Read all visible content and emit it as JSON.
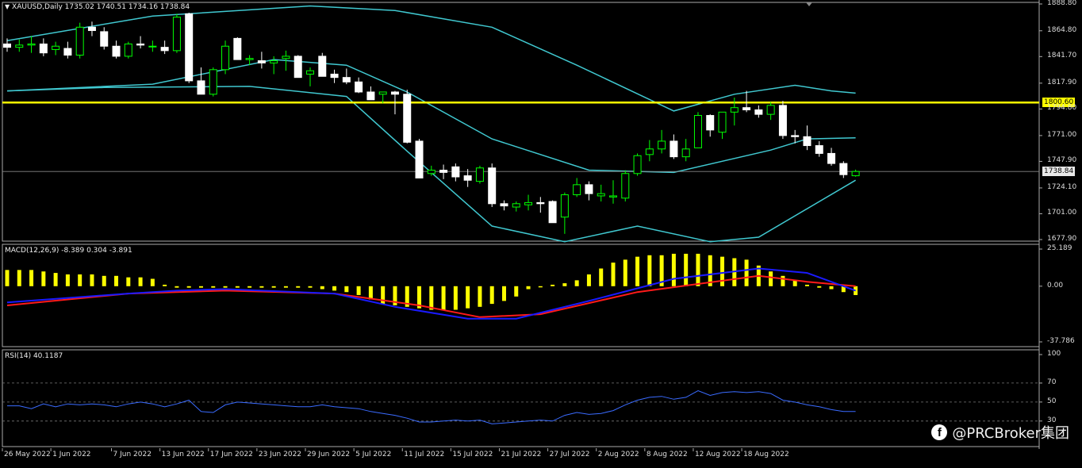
{
  "header": {
    "symbol_line": "XAUUSD,Daily  1735.02 1740.51 1734.16 1738.84",
    "macd_label": "MACD(12,26,9) -8.389 0.304 -3.891",
    "rsi_label": "RSI(14) 40.1187"
  },
  "price_tags": {
    "resistance": "1800.60",
    "last": "1738.84"
  },
  "watermark": {
    "text": "@PRCBroker集团",
    "icon": "facebook-icon"
  },
  "colors": {
    "background": "#000000",
    "bull": "#00ff00",
    "bear_fill": "#ffffff",
    "bollinger": "#40c8d0",
    "resistance": "#ffff00",
    "macd_hist": "#ffff00",
    "macd_line": "#1a1aff",
    "signal_line": "#ff1a1a",
    "rsi_line": "#3a6bff"
  },
  "chart_data": [
    {
      "type": "candlestick",
      "title": "XAUUSD,Daily",
      "y_ticks": [
        "1888.80",
        "1864.80",
        "1841.70",
        "1817.90",
        "1794.80",
        "1771.00",
        "1747.90",
        "1724.10",
        "1701.00",
        "1677.90"
      ],
      "ylim": [
        1677.9,
        1888.8
      ],
      "x_ticks": [
        "26 May 2022",
        "1 Jun 2022",
        "7 Jun 2022",
        "13 Jun 2022",
        "17 Jun 2022",
        "23 Jun 2022",
        "29 Jun 2022",
        "5 Jul 2022",
        "11 Jul 2022",
        "15 Jul 2022",
        "21 Jul 2022",
        "27 Jul 2022",
        "2 Aug 2022",
        "8 Aug 2022",
        "12 Aug 2022",
        "18 Aug 2022"
      ],
      "last_bar": {
        "open": 1735.02,
        "high": 1740.51,
        "low": 1734.16,
        "close": 1738.84
      },
      "resistance": 1800.6,
      "ohlc": [
        [
          1853,
          1858,
          1846,
          1850
        ],
        [
          1850,
          1857,
          1846,
          1852
        ],
        [
          1852,
          1860,
          1845,
          1853
        ],
        [
          1853,
          1858,
          1842,
          1845
        ],
        [
          1848,
          1855,
          1843,
          1851
        ],
        [
          1849,
          1855,
          1840,
          1843
        ],
        [
          1843,
          1872,
          1840,
          1868
        ],
        [
          1868,
          1873,
          1860,
          1865
        ],
        [
          1864,
          1868,
          1848,
          1851
        ],
        [
          1851,
          1856,
          1840,
          1842
        ],
        [
          1842,
          1855,
          1840,
          1853
        ],
        [
          1853,
          1860,
          1849,
          1852
        ],
        [
          1851,
          1856,
          1846,
          1851
        ],
        [
          1850,
          1856,
          1844,
          1847
        ],
        [
          1847,
          1880,
          1845,
          1877
        ],
        [
          1880,
          1881,
          1818,
          1820
        ],
        [
          1820,
          1832,
          1808,
          1808
        ],
        [
          1808,
          1832,
          1806,
          1830
        ],
        [
          1830,
          1856,
          1826,
          1851
        ],
        [
          1858,
          1859,
          1842,
          1839
        ],
        [
          1839,
          1843,
          1834,
          1840
        ],
        [
          1838,
          1846,
          1831,
          1836
        ],
        [
          1836,
          1842,
          1826,
          1838
        ],
        [
          1840,
          1847,
          1829,
          1842
        ],
        [
          1842,
          1843,
          1823,
          1823
        ],
        [
          1826,
          1832,
          1815,
          1829
        ],
        [
          1842,
          1845,
          1824,
          1824
        ],
        [
          1826,
          1830,
          1818,
          1823
        ],
        [
          1823,
          1831,
          1817,
          1819
        ],
        [
          1819,
          1823,
          1809,
          1810
        ],
        [
          1810,
          1815,
          1803,
          1803
        ],
        [
          1808,
          1810,
          1800,
          1810
        ],
        [
          1810,
          1811,
          1790,
          1808
        ],
        [
          1808,
          1812,
          1764,
          1765
        ],
        [
          1766,
          1768,
          1733,
          1733
        ],
        [
          1737,
          1744,
          1735,
          1740
        ],
        [
          1740,
          1745,
          1732,
          1738
        ],
        [
          1743,
          1746,
          1730,
          1734
        ],
        [
          1735,
          1741,
          1725,
          1731
        ],
        [
          1730,
          1744,
          1728,
          1742
        ],
        [
          1742,
          1746,
          1707,
          1710
        ],
        [
          1710,
          1713,
          1704,
          1708
        ],
        [
          1707,
          1712,
          1703,
          1710
        ],
        [
          1709,
          1718,
          1704,
          1711
        ],
        [
          1711,
          1716,
          1702,
          1710
        ],
        [
          1712,
          1713,
          1700,
          1693
        ],
        [
          1698,
          1720,
          1683,
          1718
        ],
        [
          1718,
          1733,
          1716,
          1727
        ],
        [
          1727,
          1730,
          1713,
          1719
        ],
        [
          1717,
          1727,
          1712,
          1719
        ],
        [
          1716,
          1731,
          1710,
          1717
        ],
        [
          1715,
          1740,
          1712,
          1737
        ],
        [
          1737,
          1755,
          1735,
          1753
        ],
        [
          1754,
          1767,
          1748,
          1759
        ],
        [
          1759,
          1776,
          1755,
          1766
        ],
        [
          1766,
          1772,
          1750,
          1752
        ],
        [
          1752,
          1768,
          1748,
          1759
        ],
        [
          1760,
          1792,
          1760,
          1789
        ],
        [
          1789,
          1790,
          1770,
          1776
        ],
        [
          1774,
          1792,
          1768,
          1792
        ],
        [
          1792,
          1805,
          1780,
          1796
        ],
        [
          1796,
          1811,
          1792,
          1794
        ],
        [
          1794,
          1798,
          1787,
          1790
        ],
        [
          1790,
          1801,
          1785,
          1798
        ],
        [
          1798,
          1802,
          1768,
          1771
        ],
        [
          1771,
          1776,
          1764,
          1770
        ],
        [
          1770,
          1780,
          1758,
          1762
        ],
        [
          1762,
          1766,
          1752,
          1755
        ],
        [
          1755,
          1760,
          1744,
          1746
        ],
        [
          1746,
          1748,
          1733,
          1736
        ],
        [
          1735.02,
          1740.51,
          1734.16,
          1738.84
        ]
      ],
      "bollinger_upper": [
        [
          0,
          1856
        ],
        [
          12,
          1878
        ],
        [
          25,
          1887
        ],
        [
          32,
          1883
        ],
        [
          40,
          1868
        ],
        [
          47,
          1834
        ],
        [
          55,
          1793
        ],
        [
          60,
          1808
        ],
        [
          65,
          1816
        ],
        [
          68,
          1811
        ],
        [
          70,
          1809
        ]
      ],
      "bollinger_middle": [
        [
          0,
          1811
        ],
        [
          12,
          1817
        ],
        [
          22,
          1839
        ],
        [
          28,
          1834
        ],
        [
          33,
          1810
        ],
        [
          40,
          1768
        ],
        [
          48,
          1740
        ],
        [
          55,
          1738
        ],
        [
          63,
          1758
        ],
        [
          66,
          1768
        ],
        [
          70,
          1769
        ]
      ],
      "bollinger_lower": [
        [
          0,
          1811
        ],
        [
          8,
          1814
        ],
        [
          20,
          1815
        ],
        [
          28,
          1806
        ],
        [
          33,
          1757
        ],
        [
          40,
          1690
        ],
        [
          46,
          1676
        ],
        [
          52,
          1690
        ],
        [
          58,
          1676
        ],
        [
          62,
          1680
        ],
        [
          70,
          1731
        ]
      ]
    },
    {
      "type": "bar",
      "title": "MACD(12,26,9)",
      "values_label": "-8.389 0.304 -3.891",
      "y_ticks": [
        "25.189",
        "0.00",
        "-37.786"
      ],
      "ylim": [
        -37.786,
        25.189
      ],
      "histogram": [
        11,
        11,
        11,
        10,
        9,
        8,
        8,
        8,
        7,
        7,
        6,
        6,
        5,
        1,
        -1,
        -1,
        -1,
        -1,
        -1,
        -1,
        -1,
        -1,
        -1,
        -1,
        -1,
        -1,
        -2,
        -3,
        -4,
        -6,
        -9,
        -12,
        -13,
        -14,
        -15,
        -16,
        -16,
        -16,
        -15,
        -14,
        -12,
        -10,
        -7,
        -2,
        0,
        1,
        2,
        4,
        8,
        12,
        16,
        18,
        20,
        21,
        21,
        22,
        22,
        22,
        21,
        20,
        19,
        18,
        14,
        10,
        7,
        4,
        1,
        -1,
        -2,
        -4,
        -6
      ],
      "macd_line": [
        [
          0,
          -11
        ],
        [
          10,
          -5
        ],
        [
          14,
          -3
        ],
        [
          18,
          -2
        ],
        [
          27,
          -5
        ],
        [
          32,
          -14
        ],
        [
          38,
          -22
        ],
        [
          42,
          -22
        ],
        [
          48,
          -10
        ],
        [
          55,
          5
        ],
        [
          62,
          12
        ],
        [
          66,
          9
        ],
        [
          70,
          -3
        ]
      ],
      "signal_line": [
        [
          0,
          -13
        ],
        [
          10,
          -5
        ],
        [
          18,
          -3
        ],
        [
          27,
          -5
        ],
        [
          34,
          -13
        ],
        [
          39,
          -21
        ],
        [
          44,
          -19
        ],
        [
          52,
          -4
        ],
        [
          62,
          7
        ],
        [
          66,
          3
        ],
        [
          70,
          0
        ]
      ]
    },
    {
      "type": "line",
      "title": "RSI(14)",
      "values_label": "40.1187",
      "y_ticks": [
        "100",
        "70",
        "50",
        "30"
      ],
      "ylim": [
        0,
        100
      ],
      "levels": [
        70,
        50,
        30
      ],
      "values": [
        46,
        46,
        43,
        48,
        45,
        48,
        47,
        48,
        47,
        45,
        48,
        50,
        48,
        45,
        48,
        52,
        40,
        39,
        47,
        50,
        49,
        48,
        47,
        46,
        45,
        45,
        47,
        45,
        44,
        43,
        40,
        38,
        36,
        33,
        29,
        29,
        30,
        31,
        30,
        31,
        27,
        28,
        29,
        30,
        31,
        30,
        36,
        39,
        37,
        38,
        41,
        47,
        52,
        55,
        56,
        53,
        55,
        62,
        57,
        60,
        61,
        60,
        61,
        59,
        52,
        50,
        47,
        45,
        42,
        40,
        40.12
      ]
    }
  ]
}
